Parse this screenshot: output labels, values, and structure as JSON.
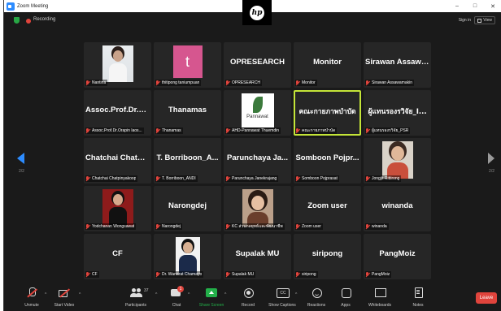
{
  "window": {
    "title": "Zoom Meeting",
    "minimize": "–",
    "maximize": "□",
    "close": "✕"
  },
  "topbar": {
    "recording_label": "Recording",
    "signin_label": "Sign in",
    "view_label": "View",
    "hp_logo_text": "hp"
  },
  "pagination": {
    "left": "2/2",
    "right": "2/2"
  },
  "tiles": [
    {
      "title": "",
      "name": "Nantina",
      "photo": "nantina"
    },
    {
      "title": "",
      "name": "thitipong taniumpuan",
      "photo": "avatar-t",
      "avatar_letter": "t",
      "avatar_color": "#d6568f"
    },
    {
      "title": "OPRESEARCH",
      "name": "OPRESEARCH"
    },
    {
      "title": "Monitor",
      "name": "Monitor"
    },
    {
      "title": "Sirawan  Assawa...",
      "name": "Sirawan Assawamakin"
    },
    {
      "title": "Assoc.Prof.Dr.O...",
      "name": "Assoc.Prof.Dr.Orapin laos..."
    },
    {
      "title": "Thanamas",
      "name": "Thanamas"
    },
    {
      "title": "",
      "name": "AHD-Pannawat Thuemdin",
      "photo": "pannawat",
      "brand": "Pannawat"
    },
    {
      "title": "คณะกายภาพบำบัด",
      "name": "คณะกายภาพบำบัด",
      "active": true,
      "thai": true
    },
    {
      "title": "ผู้แทนรองรวิจัย_I...",
      "name": "ผู้แทนรองรวิจัย_PSR",
      "thai": true
    },
    {
      "title": "Chatchai  Chatpi...",
      "name": "Chatchai Chatpinyakoop"
    },
    {
      "title": "T. Borriboon_A...",
      "name": "T. Borriboon_ANDI"
    },
    {
      "title": "Parunchaya  Ja...",
      "name": "Parunchaya Janekrajang"
    },
    {
      "title": "Somboon  Pojpr...",
      "name": "Somboon Pojprasat"
    },
    {
      "title": "",
      "name": "Jongjit Rittirong",
      "photo": "jongjit"
    },
    {
      "title": "",
      "name": "Yodchanan Wongsawat",
      "photo": "yod"
    },
    {
      "title": "Narongdej",
      "name": "Narongdej"
    },
    {
      "title": "",
      "name": "KC ส่วนกลยุทธ์และพัฒนาชีพ",
      "photo": "kc"
    },
    {
      "title": "Zoom  user",
      "name": "Zoom user"
    },
    {
      "title": "winanda",
      "name": "winanda"
    },
    {
      "title": "CF",
      "name": "CF"
    },
    {
      "title": "",
      "name": "Dr. Wanarat Chamayo",
      "photo": "wana"
    },
    {
      "title": "Supalak  MU",
      "name": "Supalak MU"
    },
    {
      "title": "siripong",
      "name": "siripong"
    },
    {
      "title": "PangMoiz",
      "name": "PangMoiz"
    }
  ],
  "toolbar": {
    "unmute": "Unmute",
    "start_video": "Start Video",
    "participants": "Participants",
    "participants_count": "37",
    "chat": "Chat",
    "chat_badge": "1",
    "share_screen": "Share Screen",
    "record": "Record",
    "captions": "Show Captions",
    "reactions": "Reactions",
    "apps": "Apps",
    "whiteboards": "Whiteboards",
    "notes": "Notes",
    "leave": "Leave",
    "caret": "^"
  },
  "colors": {
    "accent": "#2d8cff",
    "share_green": "#23b04a",
    "leave_red": "#e0443c",
    "active_speaker": "#c4e538"
  }
}
